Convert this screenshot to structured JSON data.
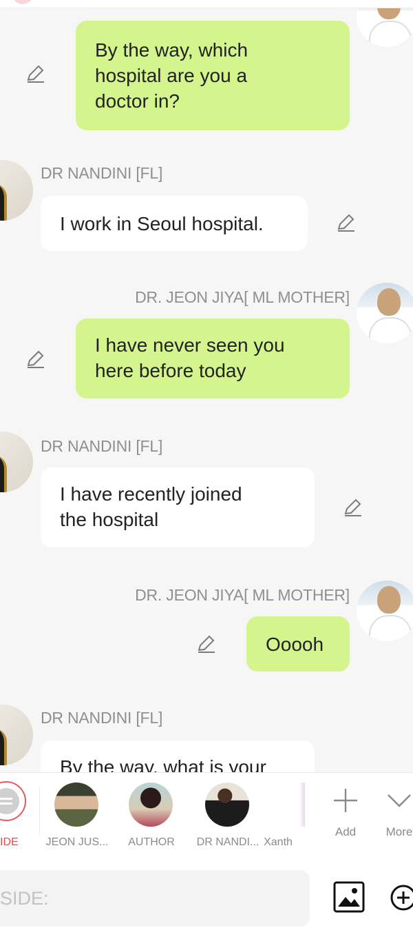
{
  "messages": [
    {
      "side": "right",
      "sender": "",
      "text_lines": [
        "By the way, which",
        "hospital are you a",
        "doctor in?"
      ]
    },
    {
      "side": "left",
      "sender": "DR NANDINI [FL]",
      "text_lines": [
        "I work in Seoul hospital."
      ]
    },
    {
      "side": "right",
      "sender": "DR. JEON JIYA[ ML MOTHER]",
      "text_lines": [
        "I have never seen you",
        "here before today"
      ]
    },
    {
      "side": "left",
      "sender": "DR NANDINI [FL]",
      "text_lines": [
        "I have recently joined",
        "the hospital"
      ]
    },
    {
      "side": "right",
      "sender": "DR. JEON JIYA[ ML MOTHER]",
      "text_lines": [
        "Ooooh"
      ]
    },
    {
      "side": "left",
      "sender": "DR NANDINI [FL]",
      "text_lines": [
        "By the way, what is your"
      ]
    }
  ],
  "character_bar": {
    "side_label": "IDE",
    "characters": [
      {
        "name": "JEON JUS..."
      },
      {
        "name": "AUTHOR"
      },
      {
        "name": "DR NANDI..."
      },
      {
        "name": "Xanth"
      }
    ],
    "add_label": "Add",
    "more_label": "More"
  },
  "input": {
    "placeholder": "SIDE:"
  },
  "colors": {
    "right_bubble": "#d4f58d",
    "left_bubble": "#ffffff",
    "background": "#f6f6f6",
    "side_accent": "#e65a5a"
  },
  "icons": [
    "edit-icon",
    "add-icon",
    "chevron-down-icon",
    "image-icon",
    "plus-circle-icon"
  ]
}
